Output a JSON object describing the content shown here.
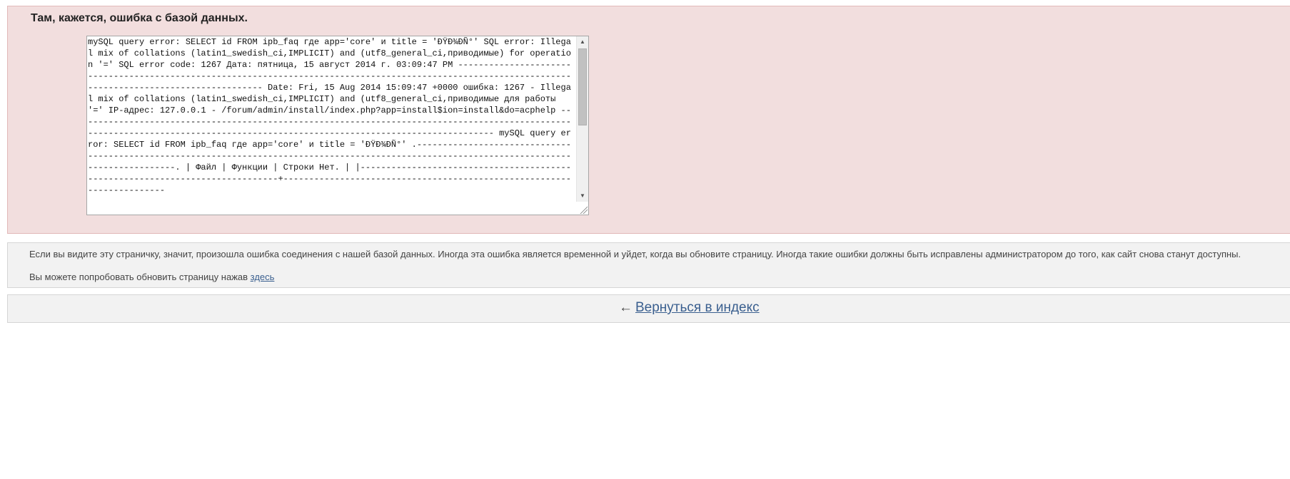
{
  "error": {
    "title": "Там, кажется, ошибка с базой данных.",
    "log": "mySQL query error: SELECT id FROM ipb_faq где app='core' и title = 'ÐŸÐ¾ÐÑ°' SQL error: Illegal mix of collations (latin1_swedish_ci,IMPLICIT) and (utf8_general_ci,приводимые) for operation '=' SQL error code: 1267 Дата: пятница, 15 август 2014 г. 03:09:47 PM ------------------------------------------------------------------------------------------------------------------------------------------------------ Date: Fri, 15 Aug 2014 15:09:47 +0000 ошибка: 1267 - Illegal mix of collations (latin1_swedish_ci,IMPLICIT) and (utf8_general_ci,приводимые для работы '=' IP-адрес: 127.0.0.1 - /forum/admin/install/index.php?app=install$ion=install&do=acphelp ------------------------------------------------------------------------------------------------------------------------------------------------------------------------------- mySQL query error: SELECT id FROM ipb_faq где app='core' и title = 'ÐŸÐ¾ÐÑ°' .---------------------------------------------------------------------------------------------------------------------------------------------. | Файл | Функции | Строки Нет. | |------------------------------------------------------------------------------+-----------------------------------------------------------------------"
  },
  "info": {
    "line1": "Если вы видите эту страничку, значит, произошла ошибка соединения с нашей базой данных. Иногда эта ошибка является временной и уйдет, когда вы обновите страницу. Иногда такие ошибки должны быть исправлены администратором до того, как сайт снова станут доступны.",
    "line2_prefix": "Вы можете попробовать обновить страницу нажав",
    "line2_link": "здесь"
  },
  "back": {
    "arrow": "←",
    "link": "Вернуться в индекс"
  },
  "scrollbar": {
    "up_arrow": "▲",
    "down_arrow": "▼"
  }
}
